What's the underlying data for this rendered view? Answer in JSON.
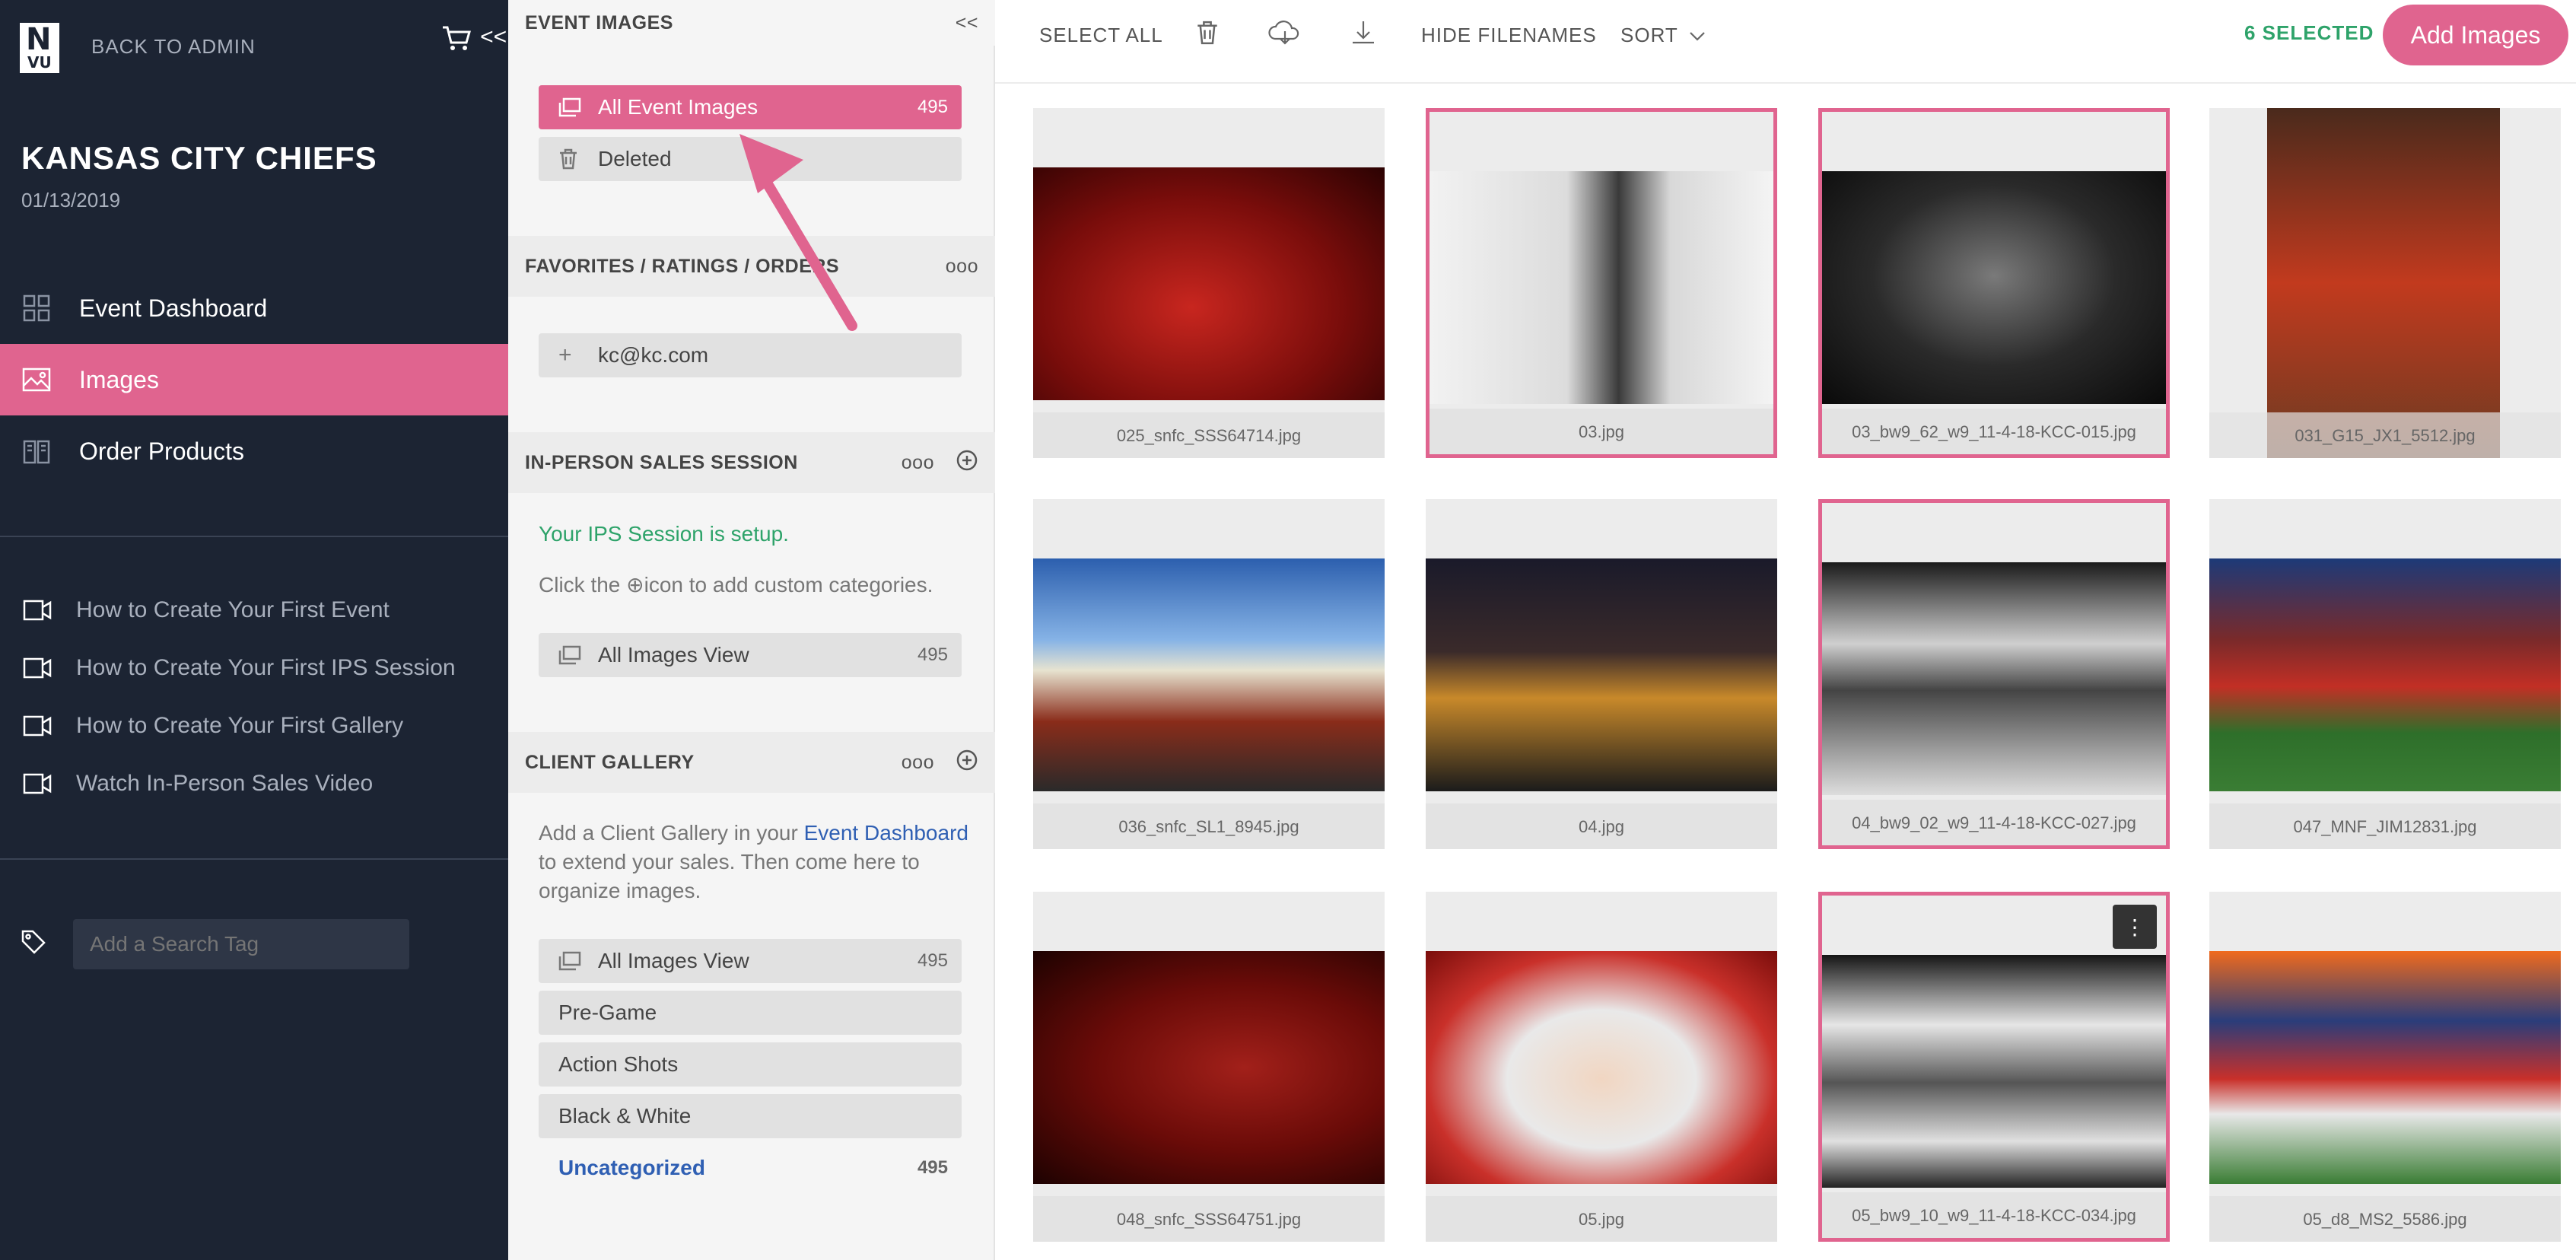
{
  "sidebar": {
    "back_label": "BACK TO ADMIN",
    "cart_label": "<<",
    "event_name": "KANSAS CITY CHIEFS",
    "event_date": "01/13/2019",
    "nav": [
      {
        "label": "Event Dashboard"
      },
      {
        "label": "Images"
      },
      {
        "label": "Order Products"
      }
    ],
    "help": [
      {
        "label": "How to Create Your First Event"
      },
      {
        "label": "How to Create Your First IPS Session"
      },
      {
        "label": "How to Create Your First Gallery"
      },
      {
        "label": "Watch In-Person Sales Video"
      }
    ],
    "search_tag_placeholder": "Add a Search Tag"
  },
  "panel": {
    "event_images": {
      "title": "EVENT IMAGES",
      "collapse": "<<",
      "all_label": "All Event Images",
      "all_count": "495",
      "deleted_label": "Deleted"
    },
    "favorites": {
      "title": "FAVORITES / RATINGS / ORDERS",
      "more": "ooo",
      "user": "kc@kc.com"
    },
    "ips": {
      "title": "IN-PERSON SALES SESSION",
      "more": "ooo",
      "status": "Your IPS Session is setup.",
      "hint_pre": "Click the ",
      "hint_post": "icon to add custom categories.",
      "view_label": "All Images View",
      "view_count": "495"
    },
    "gallery": {
      "title": "CLIENT GALLERY",
      "more": "ooo",
      "desc_pre": "Add a Client Gallery in your ",
      "desc_link": "Event Dashboard",
      "desc_post": " to extend your sales. Then come here to organize images.",
      "view_label": "All Images View",
      "view_count": "495",
      "categories": [
        "Pre-Game",
        "Action Shots",
        "Black & White"
      ],
      "uncategorized": "Uncategorized",
      "uncategorized_count": "495"
    }
  },
  "toolbar": {
    "select_all": "SELECT ALL",
    "hide_filenames": "HIDE FILENAMES",
    "sort": "SORT",
    "selected": "6 SELECTED",
    "add_images": "Add Images"
  },
  "images": [
    {
      "name": "025_snfc_SSS64714.jpg",
      "selected": false
    },
    {
      "name": "03.jpg",
      "selected": true
    },
    {
      "name": "03_bw9_62_w9_11-4-18-KCC-015.jpg",
      "selected": true
    },
    {
      "name": "031_G15_JX1_5512.jpg",
      "selected": false
    },
    {
      "name": "036_snfc_SL1_8945.jpg",
      "selected": false
    },
    {
      "name": "04.jpg",
      "selected": false
    },
    {
      "name": "04_bw9_02_w9_11-4-18-KCC-027.jpg",
      "selected": true
    },
    {
      "name": "047_MNF_JIM12831.jpg",
      "selected": false
    },
    {
      "name": "048_snfc_SSS64751.jpg",
      "selected": false
    },
    {
      "name": "05.jpg",
      "selected": false
    },
    {
      "name": "05_bw9_10_w9_11-4-18-KCC-034.jpg",
      "selected": true
    },
    {
      "name": "05_d8_MS2_5586.jpg",
      "selected": false
    }
  ],
  "colors": {
    "accent": "#e0648f",
    "sidebar_bg": "#1c2433",
    "success": "#2ea36a",
    "link": "#2f5fb3"
  }
}
